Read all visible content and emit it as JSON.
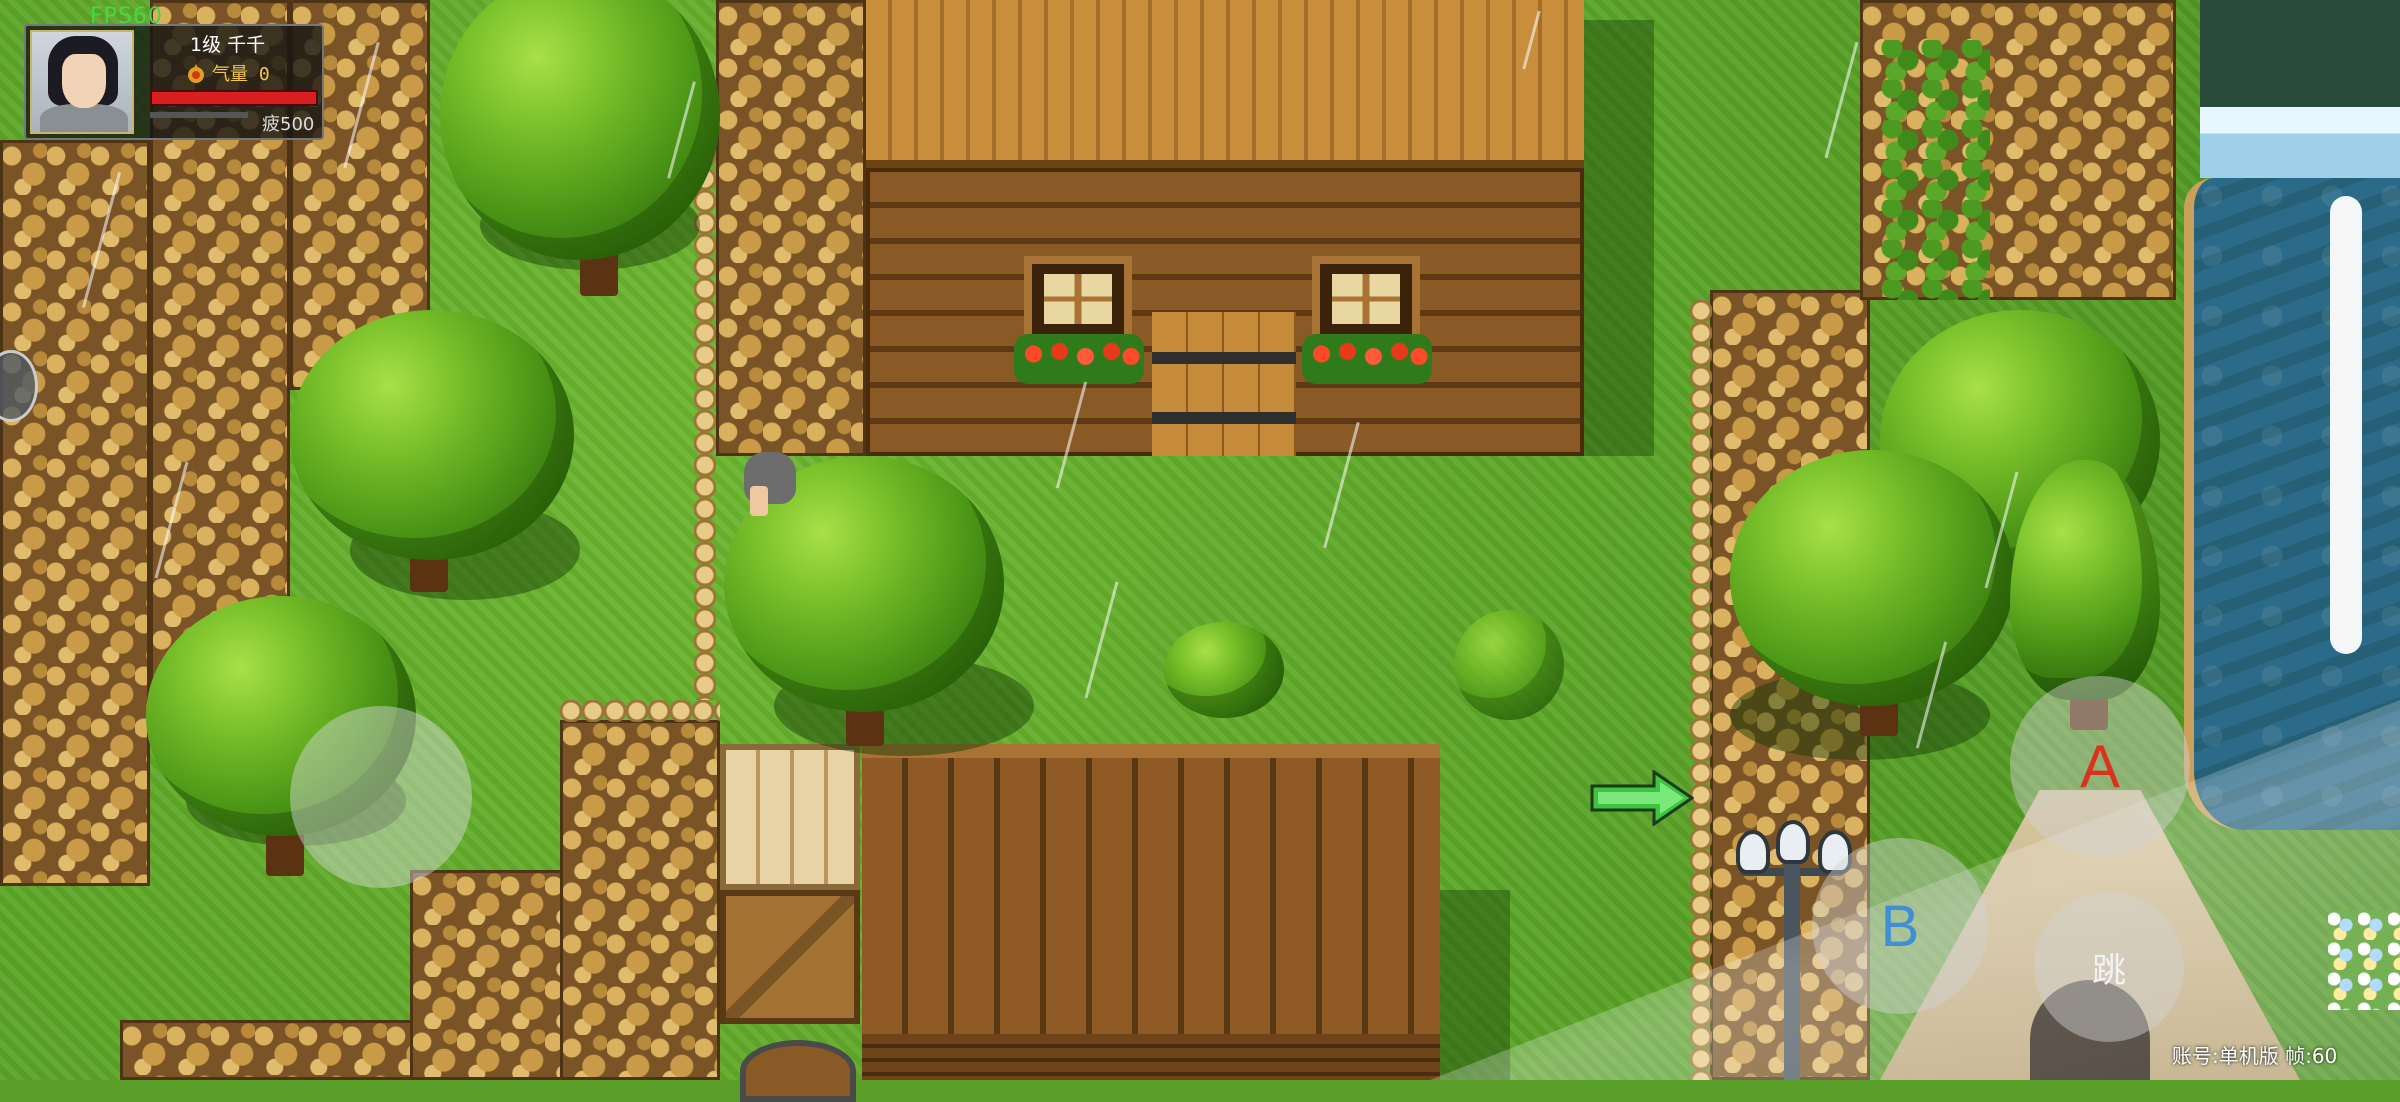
{
  "hud": {
    "fps": "FPS60",
    "level_name": "1级 千千",
    "qi": "气量 0",
    "fatigue": "疲500"
  },
  "controls": {
    "a_label": "A",
    "b_label": "B",
    "jump_label": "跳"
  },
  "footer": {
    "account": "账号:单机版 帧:60"
  },
  "icons": {
    "go_arrow": "right-arrow-icon",
    "qi": "flame-icon",
    "side": "round-menu-icon"
  },
  "colors": {
    "fps": "#46d846",
    "hp_bar": "#d81e1e",
    "button_a": "#d8331f",
    "button_b": "#3f8fd8",
    "arrow": "#3ec43e"
  },
  "player": {
    "hp_fraction": 1.0,
    "fatigue_fraction": 0.6
  }
}
